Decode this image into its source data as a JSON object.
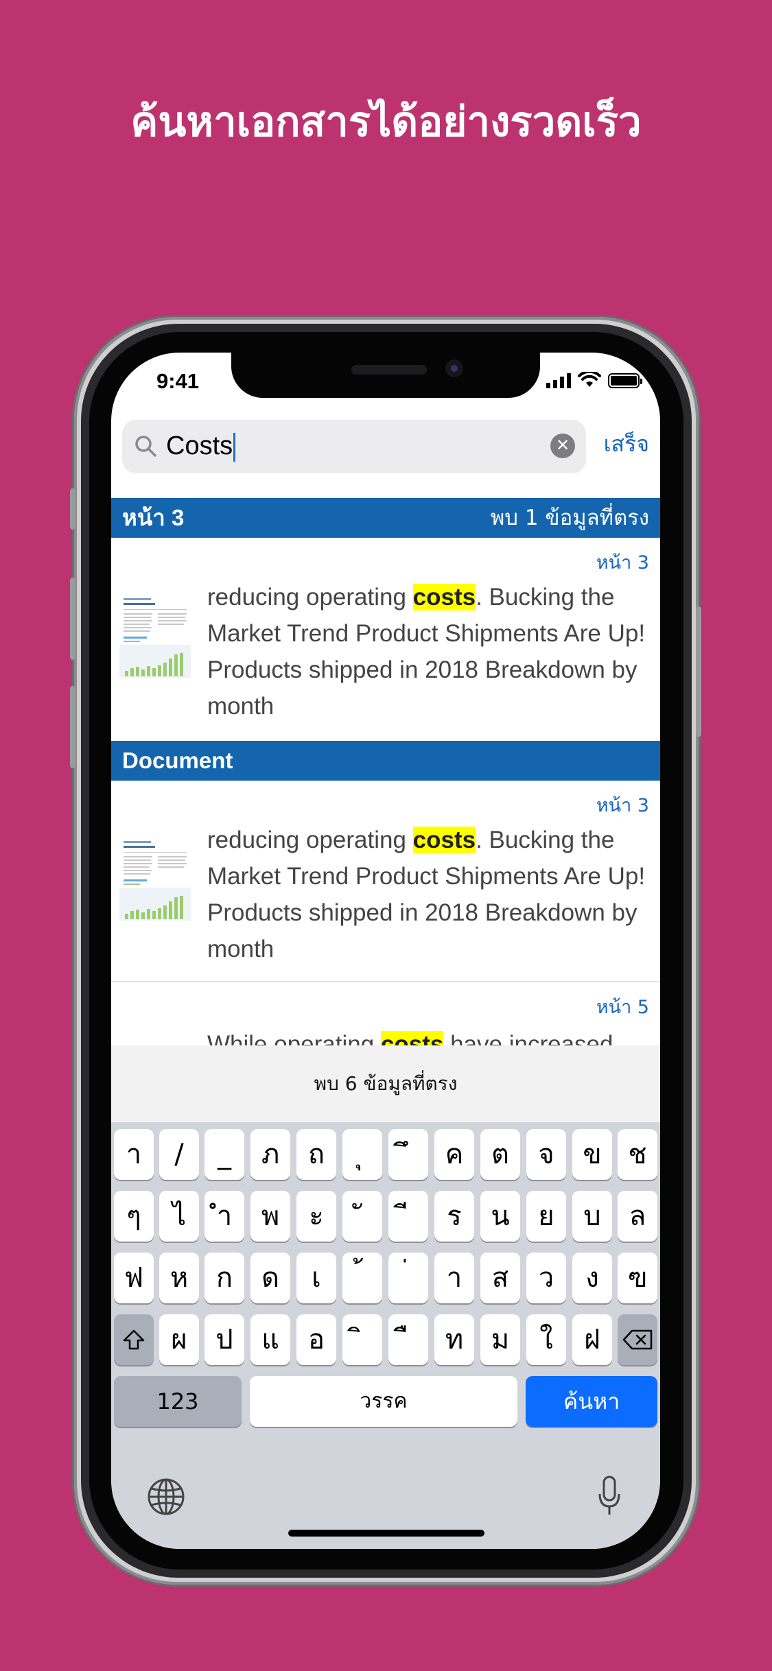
{
  "headline": "ค้นหาเอกสารได้อย่างรวดเร็ว",
  "status_bar": {
    "time": "9:41"
  },
  "search": {
    "query": "Costs",
    "done_label": "เสร็จ"
  },
  "sections": [
    {
      "title": "หน้า 3",
      "match_count": "พบ 1 ข้อมูลที่ตรง",
      "results": [
        {
          "page": "หน้า 3",
          "before": "reducing operating ",
          "highlight": "costs",
          "after": ". Bucking the Market Trend Product Shipments Are Up! Products shipped in 2018 Breakdown by month"
        }
      ]
    },
    {
      "title": "Document",
      "results": [
        {
          "page": "หน้า 3",
          "before": "reducing operating ",
          "highlight": "costs",
          "after": ". Bucking the Market Trend Product Shipments Are Up! Products shipped in 2018 Breakdown by month"
        },
        {
          "page": "หน้า 5",
          "before": "While operating ",
          "highlight": "costs",
          "after": " have increased"
        }
      ]
    }
  ],
  "matches_total": "พบ 6 ข้อมูลที่ตรง",
  "keyboard": {
    "row1": [
      "า",
      "/",
      "_",
      "ภ",
      "ถ",
      "ุ",
      "ึ",
      "ค",
      "ต",
      "จ",
      "ข",
      "ช"
    ],
    "row2": [
      "ๆ",
      "ไ",
      "ำ",
      "พ",
      "ะ",
      "ั",
      "ี",
      "ร",
      "น",
      "ย",
      "บ",
      "ล"
    ],
    "row3": [
      "ฟ",
      "ห",
      "ก",
      "ด",
      "เ",
      "้",
      "่",
      "า",
      "ส",
      "ว",
      "ง",
      "ฃ"
    ],
    "row4": [
      "ผ",
      "ป",
      "แ",
      "อ",
      "ิ",
      "ื",
      "ท",
      "ม",
      "ใ",
      "ฝ"
    ],
    "numbers_label": "123",
    "space_label": "วรรค",
    "return_label": "ค้นหา"
  },
  "colors": {
    "background": "#bc3370",
    "section_header": "#1465ae",
    "accent": "#1565c0",
    "highlight": "#ffff00",
    "return_key": "#0b6cff"
  }
}
